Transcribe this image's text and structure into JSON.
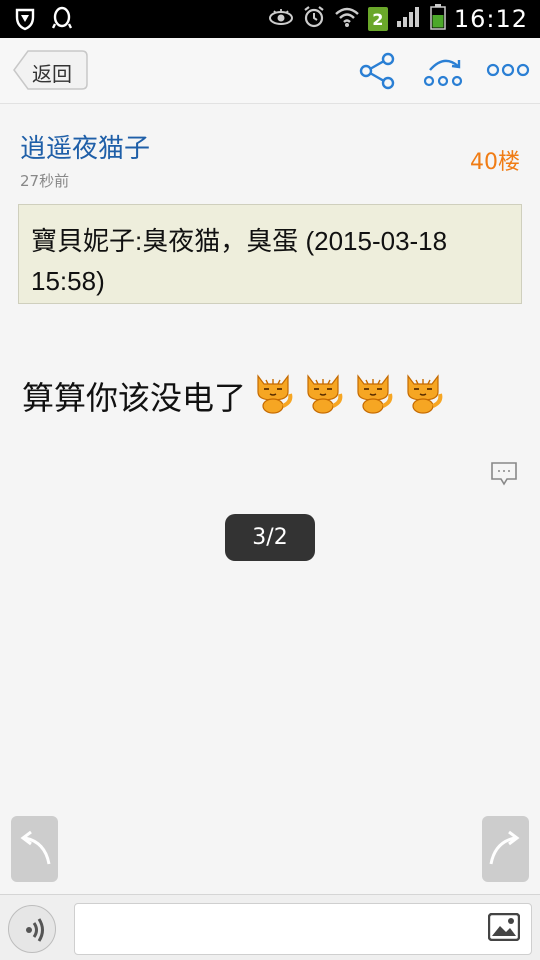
{
  "status_bar": {
    "time": "16:12",
    "sim_slot": "2"
  },
  "header": {
    "back_label": "返回",
    "icons": [
      "share-icon",
      "forward-icon",
      "more-icon"
    ]
  },
  "post": {
    "author": "逍遥夜猫子",
    "time": "27秒前",
    "floor": "40楼",
    "quote": "寶貝妮子:臭夜猫，臭蛋 (2015-03-18 15:58)",
    "body": "算算你该没电了",
    "emoji_count": 4
  },
  "pager": {
    "label": "3/2"
  },
  "colors": {
    "author": "#1f5fa8",
    "floor": "#f07c14",
    "accent": "#2a7fd4",
    "quote_bg": "#eeeedc"
  }
}
